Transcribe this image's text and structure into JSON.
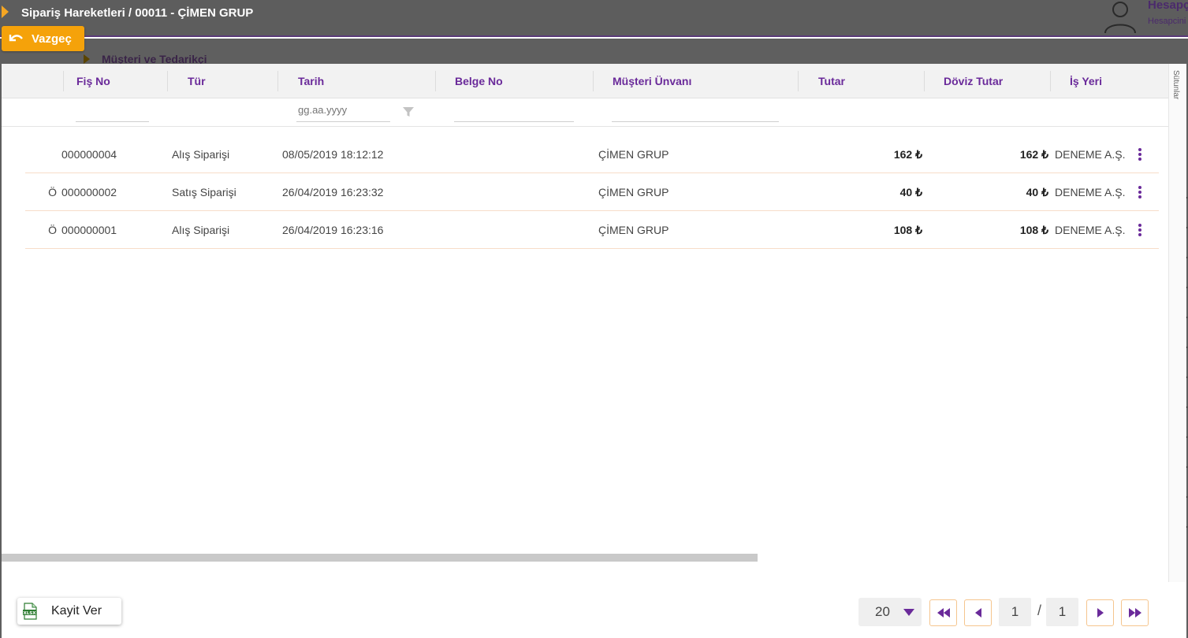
{
  "header": {
    "title": "Sipariş Hareketleri / 00011 - ÇİMEN GRUP",
    "user_name": "Hesapçı",
    "user_sub": "Hesapcini"
  },
  "cancel_button": {
    "label": "Vazgeç",
    "icon": "undo-arrow-icon"
  },
  "background_section": {
    "label": "Müşteri ve Tedarikçi"
  },
  "table": {
    "columns": [
      "Fiş No",
      "Tür",
      "Tarih",
      "Belge No",
      "Müşteri Ünvanı",
      "Tutar",
      "Döviz Tutar",
      "İş Yeri"
    ],
    "filters": {
      "date_placeholder": "gg.aa.yyyy"
    },
    "side_tab": "Sütunlar",
    "rows": [
      {
        "flag": "",
        "fis_no": "000000004",
        "tur": "Alış Siparişi",
        "tarih": "08/05/2019 18:12:12",
        "belge_no": "",
        "musteri": "ÇİMEN GRUP",
        "tutar": "162 ₺",
        "doviz_tutar": "162 ₺",
        "is_yeri": "DENEME A.Ş."
      },
      {
        "flag": "Ö",
        "fis_no": "000000002",
        "tur": "Satış Siparişi",
        "tarih": "26/04/2019 16:23:32",
        "belge_no": "",
        "musteri": "ÇİMEN GRUP",
        "tutar": "40 ₺",
        "doviz_tutar": "40 ₺",
        "is_yeri": "DENEME A.Ş."
      },
      {
        "flag": "Ö",
        "fis_no": "000000001",
        "tur": "Alış Siparişi",
        "tarih": "26/04/2019 16:23:16",
        "belge_no": "",
        "musteri": "ÇİMEN GRUP",
        "tutar": "108 ₺",
        "doviz_tutar": "108 ₺",
        "is_yeri": "DENEME A.Ş."
      }
    ]
  },
  "export_button": {
    "label": "Kayit Ver",
    "icon": "xlsx-file-icon"
  },
  "pagination": {
    "page_size": "20",
    "current_page": "1",
    "total_pages": "1",
    "separator": "/"
  },
  "colors": {
    "accent": "#6a2a9a",
    "orange": "#f5a20a",
    "row_border": "#f7ddc9"
  }
}
